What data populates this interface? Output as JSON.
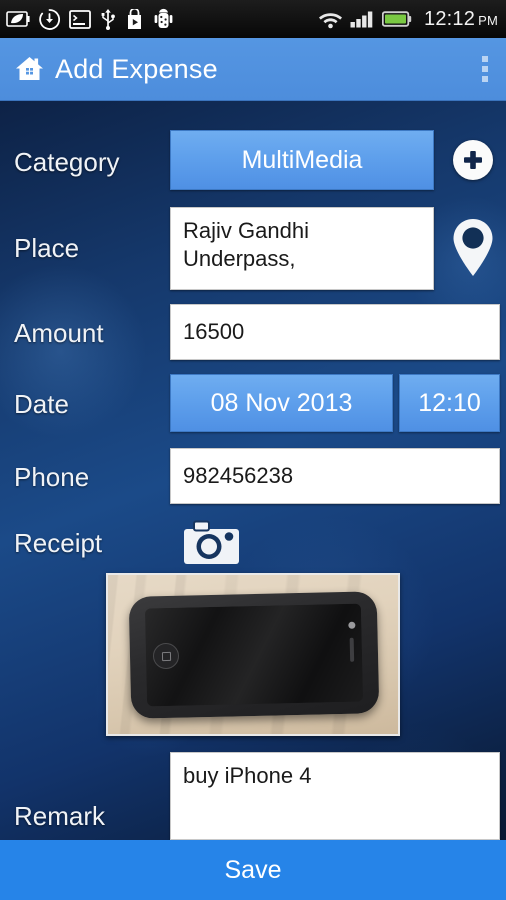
{
  "statusbar": {
    "time": "12:12",
    "ampm": "PM",
    "left_icons": [
      "power-saving-icon",
      "download-sync-icon",
      "terminal-icon",
      "usb-icon",
      "play-store-icon",
      "android-debug-icon"
    ],
    "right_icons": [
      "wifi-icon",
      "signal-bars-icon",
      "battery-icon"
    ],
    "battery_color": "#7ac943",
    "signal_bars": 4
  },
  "actionbar": {
    "home_icon": "home-icon",
    "title": "Add Expense",
    "overflow_icon": "overflow-menu-icon",
    "background": "#4d8ddc"
  },
  "form": {
    "category": {
      "label": "Category",
      "value": "MultiMedia",
      "add_icon": "plus-circle-icon"
    },
    "place": {
      "label": "Place",
      "value": "Rajiv Gandhi Underpass,",
      "map_icon": "map-pin-icon"
    },
    "amount": {
      "label": "Amount",
      "value": "16500"
    },
    "date": {
      "label": "Date",
      "value": "08 Nov 2013",
      "time": "12:10"
    },
    "phone": {
      "label": "Phone",
      "value": "982456238"
    },
    "receipt": {
      "label": "Receipt",
      "camera_icon": "camera-icon",
      "photo_alt": "black-iphone-on-wooden-table"
    },
    "remark": {
      "label": "Remark",
      "value": "buy iPhone 4"
    }
  },
  "savebar": {
    "label": "Save",
    "color": "#2684e8"
  }
}
